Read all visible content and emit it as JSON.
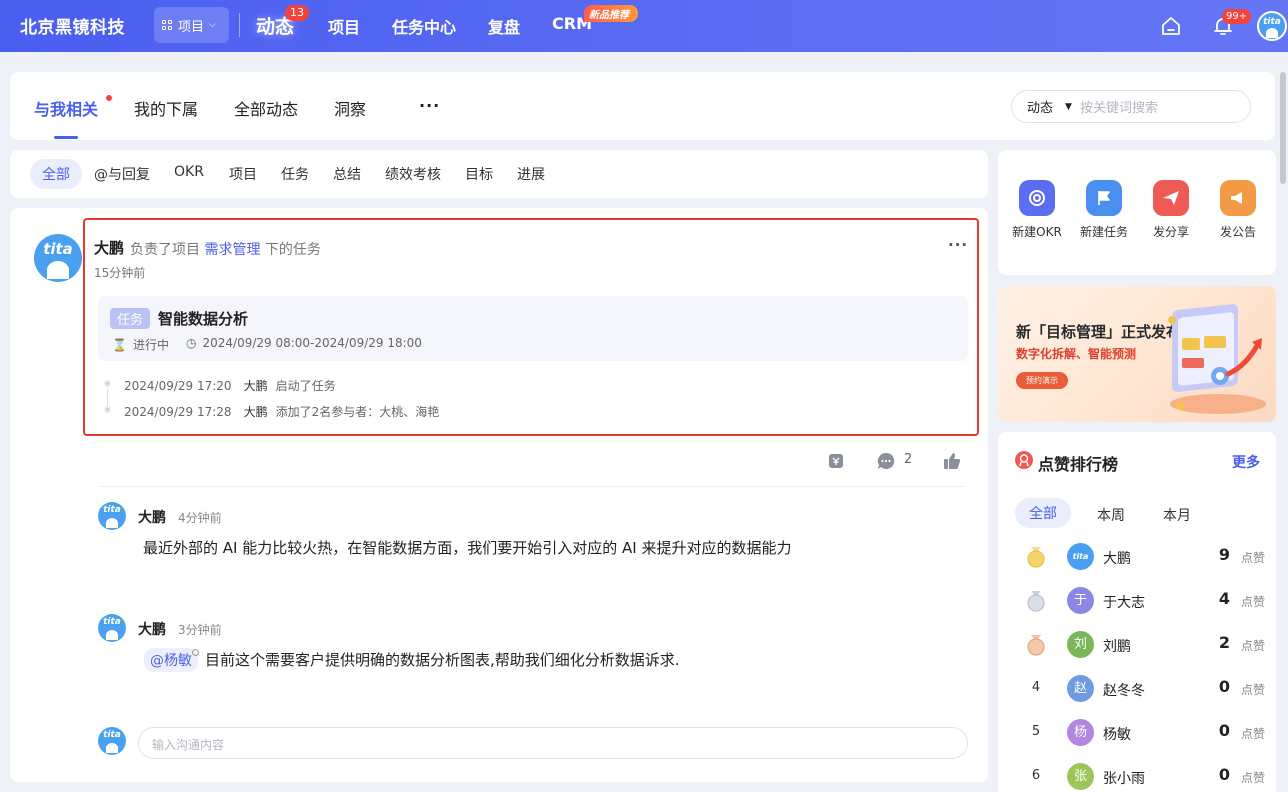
{
  "topbar": {
    "brand": "北京黑镜科技",
    "project_switch": "项目",
    "nav": [
      "动态",
      "项目",
      "任务中心",
      "复盘",
      "CRM"
    ],
    "dynamic_badge": "13",
    "crm_tag": "新品推荐",
    "notif_badge": "99+",
    "avatar_text": "tita"
  },
  "main_tabs": {
    "items": [
      "与我相关",
      "我的下属",
      "全部动态",
      "洞察"
    ],
    "more": "···",
    "search_scope": "动态",
    "search_placeholder": "按关键词搜索"
  },
  "filter_tabs": [
    "全部",
    "@与回复",
    "OKR",
    "项目",
    "任务",
    "总结",
    "绩效考核",
    "目标",
    "进展"
  ],
  "post": {
    "author": "大鹏",
    "desc_pre": "负责了项目",
    "desc_link": "需求管理",
    "desc_post": "下的任务",
    "time": "15分钟前",
    "task_tag": "任务",
    "task_name": "智能数据分析",
    "task_status": "进行中",
    "task_date": "2024/09/29 08:00-2024/09/29 18:00",
    "timeline": [
      {
        "time": "2024/09/29 17:20",
        "user": "大鹏",
        "action": "启动了任务"
      },
      {
        "time": "2024/09/29 17:28",
        "user": "大鹏",
        "action": "添加了2名参与者：大桃、海艳"
      }
    ],
    "comment_count": "2",
    "comments": [
      {
        "author": "大鹏",
        "time": "4分钟前",
        "text": "最近外部的 AI 能力比较火热，在智能数据方面，我们要开始引入对应的 AI 来提升对应的数据能力"
      },
      {
        "author": "大鹏",
        "time": "3分钟前",
        "mention": "@杨敏",
        "text": "目前这个需要客户提供明确的数据分析图表,帮助我们细化分析数据诉求."
      }
    ],
    "input_placeholder": "输入沟通内容"
  },
  "quick_actions": [
    {
      "label": "新建OKR",
      "color": "#5b6df3"
    },
    {
      "label": "新建任务",
      "color": "#4a8ff0"
    },
    {
      "label": "发分享",
      "color": "#ef5a55"
    },
    {
      "label": "发公告",
      "color": "#f39a45"
    }
  ],
  "banner": {
    "title": "新「目标管理」正式发布",
    "subtitle": "数字化拆解、智能预测",
    "button": "预约演示"
  },
  "ranking": {
    "title": "点赞排行榜",
    "more": "更多",
    "tabs": [
      "全部",
      "本周",
      "本月"
    ],
    "unit": "点赞",
    "rows": [
      {
        "rank": "1",
        "name": "大鹏",
        "count": "9",
        "avatar": "tita",
        "color": "#4aa0f0"
      },
      {
        "rank": "2",
        "name": "于大志",
        "count": "4",
        "avatar": "于",
        "color": "#8e86e6"
      },
      {
        "rank": "3",
        "name": "刘鹏",
        "count": "2",
        "avatar": "刘",
        "color": "#7cb65a"
      },
      {
        "rank": "4",
        "name": "赵冬冬",
        "count": "0",
        "avatar": "赵",
        "color": "#6f9be0"
      },
      {
        "rank": "5",
        "name": "杨敏",
        "count": "0",
        "avatar": "杨",
        "color": "#b086e0"
      },
      {
        "rank": "6",
        "name": "张小雨",
        "count": "0",
        "avatar": "张",
        "color": "#9ec55a"
      }
    ]
  }
}
